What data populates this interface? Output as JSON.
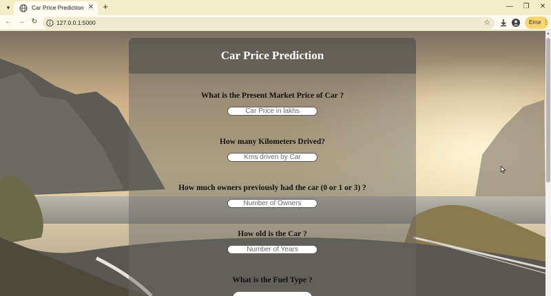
{
  "browser": {
    "tab_title": "Car Price Prediction",
    "url": "127.0.0.1:5000",
    "error_label": "Error"
  },
  "icons": {
    "tab_menu": "chevron-down-icon",
    "favicon": "globe-icon",
    "close": "close-icon",
    "new_tab": "plus-icon",
    "back": "arrow-left-icon",
    "forward": "arrow-right-icon",
    "reload": "reload-icon",
    "site_info": "info-icon",
    "bookmark": "star-icon",
    "download": "download-icon",
    "profile": "profile-icon",
    "menu": "kebab-menu-icon"
  },
  "page": {
    "title": "Car Price Prediction",
    "questions": [
      {
        "label": "What is the Present Market Price of Car ?",
        "placeholder": "Car Price in lakhs"
      },
      {
        "label": "How many Kilometers Drived?",
        "placeholder": "Kms driven by Car"
      },
      {
        "label": "How much owners previously had the car (0 or 1 or 3) ?",
        "placeholder": "Number of Owners"
      },
      {
        "label": "How old is the Car ?",
        "placeholder": "Number of Years"
      },
      {
        "label": "What is the Fuel Type ?"
      }
    ]
  },
  "colors": {
    "chrome_bg": "#f3edc8",
    "error_chip": "#f7d571",
    "title_text": "#ffffff"
  }
}
